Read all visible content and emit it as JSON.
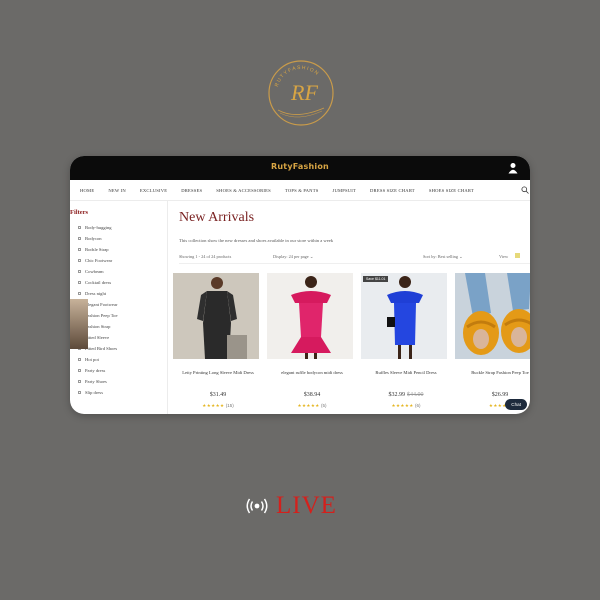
{
  "logo": {
    "monogram": "RF",
    "ring_text": "RUTYFASHION"
  },
  "site": {
    "brand": "RutyFashion",
    "nav": [
      "HOME",
      "NEW IN",
      "EXCLUSIVE",
      "DRESSES",
      "SHOES & ACCESSORIES",
      "TOPS & PANTS",
      "JUMPSUIT",
      "DRESS SIZE CHART",
      "SHOES SIZE CHART"
    ]
  },
  "sidebar": {
    "title": "Filters",
    "items": [
      "Body-hugging",
      "Bodycon",
      "Bodsle Strap",
      "Chic Footwear",
      "Cowbeam",
      "Cocktail dress",
      "Dress night",
      "Elegant Footwear",
      "Fashion Peep Toe",
      "Fashion Strap",
      "Fitted Sleeve",
      "Fitted Bird Shoes",
      "Hot pot",
      "Party dress",
      "Party Shoes",
      "Slip dress"
    ]
  },
  "main": {
    "title": "New Arrivals",
    "description": "This collection show the new dresses and shoes available in our store within a week",
    "showing": "Showing 1 - 24 of 24 products",
    "display": "Display: 24 per page ⌄",
    "sort": "Sort by: Best selling ⌄",
    "view": "View"
  },
  "products": [
    {
      "name": "Letty Printing Long Sleeve Midi Dress",
      "price": "$31.49",
      "old_price": "",
      "reviews": "(15)",
      "badge": ""
    },
    {
      "name": "elegant ruffle bodycon midi dress",
      "price": "$38.94",
      "old_price": "",
      "reviews": "(5)",
      "badge": ""
    },
    {
      "name": "Ruffles Sleeve Midi Pencil Dress",
      "price": "$32.99",
      "old_price": "$44.00",
      "reviews": "(6)",
      "badge": "Save $11.01"
    },
    {
      "name": "Buckle Strap Fashion Peep Toe",
      "price": "$26.99",
      "old_price": "",
      "reviews": "",
      "badge": ""
    }
  ],
  "chat": {
    "label": "Chat"
  },
  "live": {
    "label": "LIVE"
  },
  "colors": {
    "background": "#6b6a68",
    "brand_gold": "#d8a544",
    "title_red": "#7a2222",
    "live_red": "#d4201c",
    "star": "#e5b622"
  }
}
